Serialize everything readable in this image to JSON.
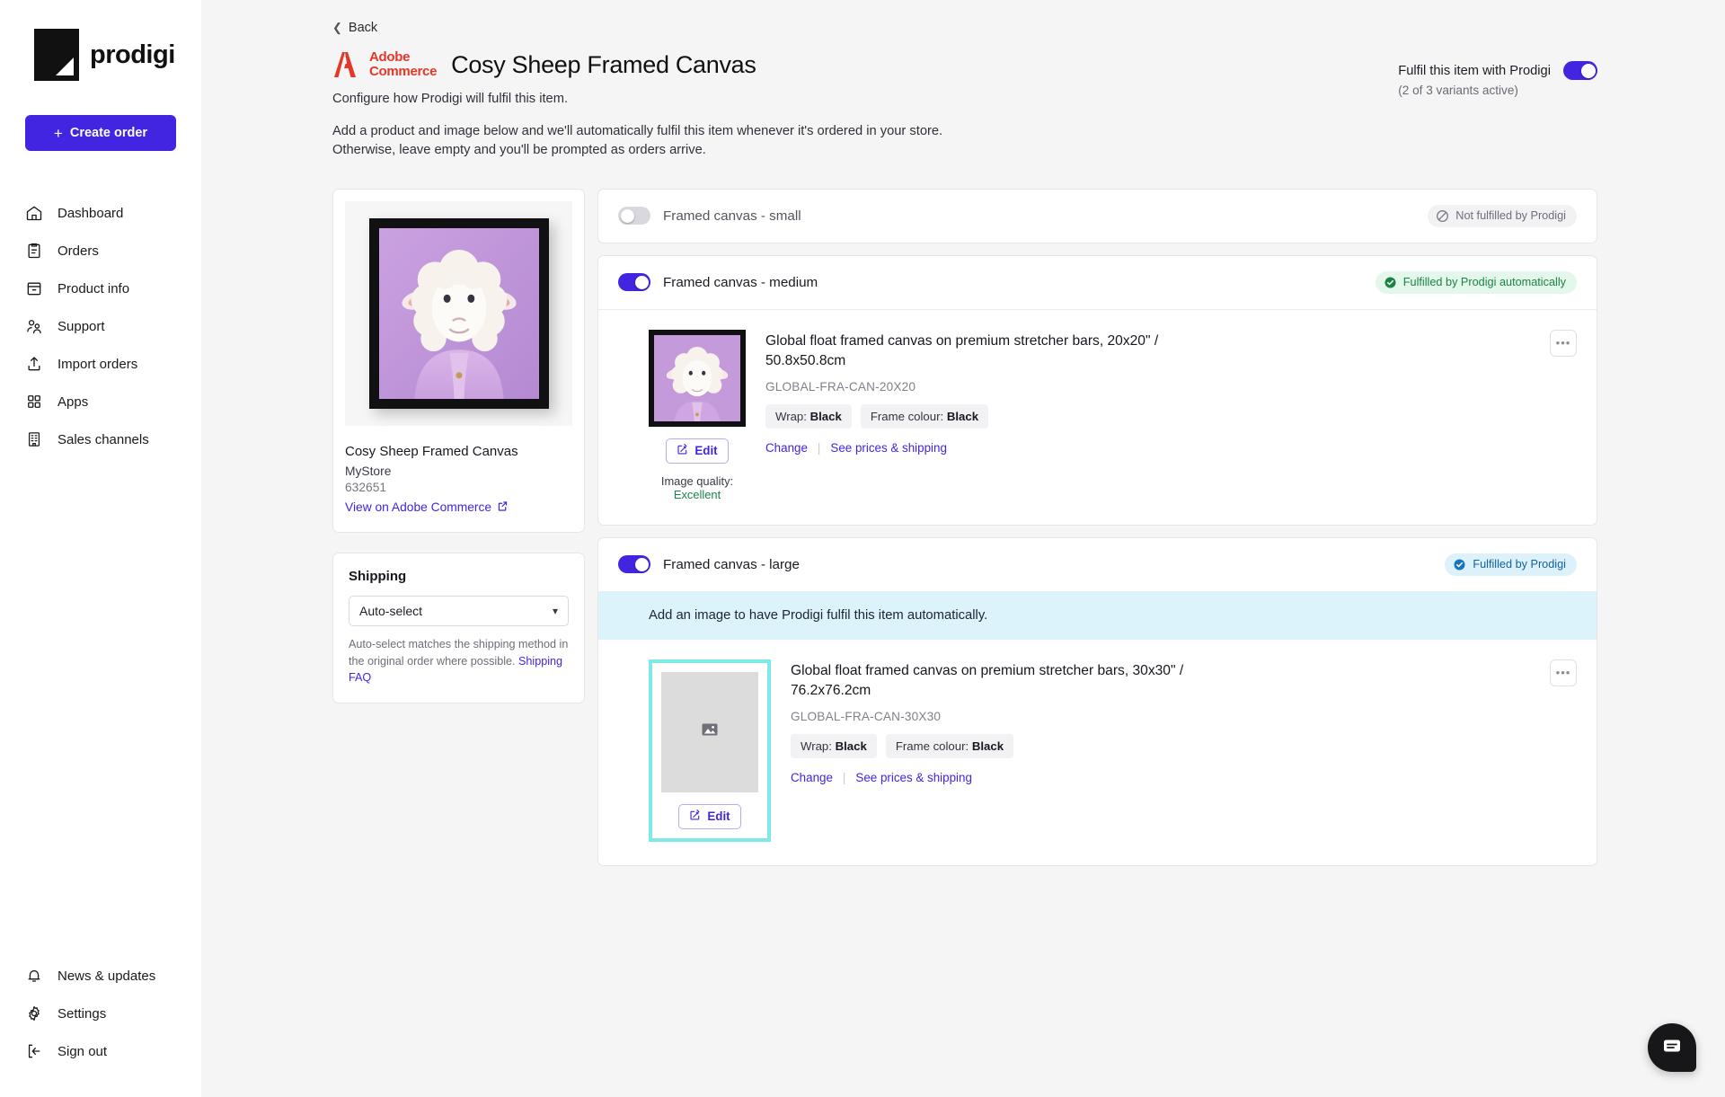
{
  "brand": {
    "name": "prodigi",
    "accent": "#4125e0"
  },
  "sidebar": {
    "create_order_label": "Create order",
    "items": [
      {
        "label": "Dashboard",
        "icon": "home-icon"
      },
      {
        "label": "Orders",
        "icon": "clipboard-icon"
      },
      {
        "label": "Product info",
        "icon": "archive-icon"
      },
      {
        "label": "Support",
        "icon": "people-icon"
      },
      {
        "label": "Import orders",
        "icon": "upload-icon"
      },
      {
        "label": "Apps",
        "icon": "grid-icon"
      },
      {
        "label": "Sales channels",
        "icon": "building-icon"
      }
    ],
    "bottom_items": [
      {
        "label": "News & updates",
        "icon": "bell-icon"
      },
      {
        "label": "Settings",
        "icon": "gear-icon"
      },
      {
        "label": "Sign out",
        "icon": "sign-out-icon"
      }
    ]
  },
  "header": {
    "back_label": "Back",
    "channel_logo": "adobe-commerce-logo",
    "channel_line1": "Adobe",
    "channel_line2": "Commerce",
    "title": "Cosy Sheep Framed Canvas",
    "subtitle": "Configure how Prodigi will fulfil this item.",
    "description_line1": "Add a product and image below and we'll automatically fulfil this item whenever it's ordered in your store.",
    "description_line2": "Otherwise, leave empty and you'll be prompted as orders arrive.",
    "fulfil_toggle_label": "Fulfil this item with Prodigi",
    "fulfil_toggle_sub": "(2 of 3 variants active)",
    "fulfil_toggle_state": "on"
  },
  "product_card": {
    "name": "Cosy Sheep Framed Canvas",
    "store": "MyStore",
    "sku": "632651",
    "link_label": "View on Adobe Commerce",
    "link_icon": "external-link-icon",
    "image_alt": "cosy-sheep-framed-canvas-preview"
  },
  "shipping_card": {
    "title": "Shipping",
    "selected": "Auto-select",
    "options": [
      "Auto-select"
    ],
    "note": "Auto-select matches the shipping method in the original order where possible.",
    "note_link": "Shipping FAQ"
  },
  "variants": [
    {
      "name": "Framed canvas - small",
      "toggle_state": "off",
      "badge": {
        "text": "Not fulfilled by Prodigi",
        "style": "grey",
        "icon": "no-entry-icon"
      },
      "has_body": false
    },
    {
      "name": "Framed canvas - medium",
      "toggle_state": "on",
      "badge": {
        "text": "Fulfilled by Prodigi automatically",
        "style": "green",
        "icon": "check-circle-icon"
      },
      "has_body": true,
      "notice": null,
      "highlighted": false,
      "thumb_type": "image",
      "product_title": "Global float framed canvas on premium stretcher bars, 20x20\" / 50.8x50.8cm",
      "product_code": "GLOBAL-FRA-CAN-20X20",
      "chips": [
        {
          "label": "Wrap:",
          "value": "Black"
        },
        {
          "label": "Frame colour:",
          "value": "Black"
        }
      ],
      "links": [
        "Change",
        "See prices & shipping"
      ],
      "edit_label": "Edit",
      "image_quality_label": "Image quality:",
      "image_quality_value": "Excellent",
      "kebab_label": "•••"
    },
    {
      "name": "Framed canvas - large",
      "toggle_state": "on",
      "badge": {
        "text": "Fulfilled by Prodigi",
        "style": "blue",
        "icon": "check-circle-filled-icon"
      },
      "has_body": true,
      "notice": "Add an image to have Prodigi fulfil this item automatically.",
      "highlighted": true,
      "thumb_type": "placeholder",
      "product_title": "Global float framed canvas on premium stretcher bars, 30x30\" / 76.2x76.2cm",
      "product_code": "GLOBAL-FRA-CAN-30X30",
      "chips": [
        {
          "label": "Wrap:",
          "value": "Black"
        },
        {
          "label": "Frame colour:",
          "value": "Black"
        }
      ],
      "links": [
        "Change",
        "See prices & shipping"
      ],
      "edit_label": "Edit",
      "image_quality_label": null,
      "image_quality_value": null,
      "kebab_label": "•••"
    }
  ],
  "chat": {
    "icon": "chat-bubble-icon"
  },
  "colors": {
    "accent": "#4125e0",
    "highlight_border": "#7fe9ea",
    "notice_bg": "#ddf3fb",
    "badge_green_bg": "#e3f7ea",
    "badge_green_fg": "#1c8347",
    "badge_blue_bg": "#ddf1fb",
    "badge_blue_fg": "#1261a0",
    "adobe_red": "#e3372a"
  }
}
